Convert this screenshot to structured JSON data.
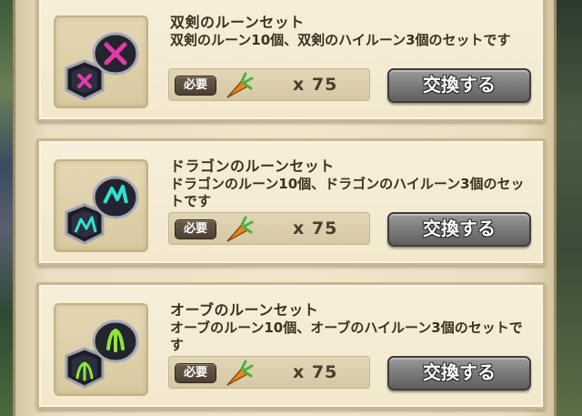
{
  "offers": [
    {
      "title": "双剣のルーンセット",
      "description": "双剣のルーン10個、双剣のハイルーン3個のセットです",
      "required_label": "必要",
      "currency_icon": "carrot-icon",
      "cost": "x 75",
      "button_label": "交換する",
      "rune_color": "#e23aa8"
    },
    {
      "title": "ドラゴンのルーンセット",
      "description": "ドラゴンのルーン10個、ドラゴンのハイルーン3個のセットです",
      "required_label": "必要",
      "currency_icon": "carrot-icon",
      "cost": "x 75",
      "button_label": "交換する",
      "rune_color": "#2fe3d4"
    },
    {
      "title": "オーブのルーンセット",
      "description": "オーブのルーン10個、オーブのハイルーン3個のセットです",
      "required_label": "必要",
      "currency_icon": "carrot-icon",
      "cost": "x 75",
      "button_label": "交換する",
      "rune_color": "#8fe63a"
    }
  ]
}
